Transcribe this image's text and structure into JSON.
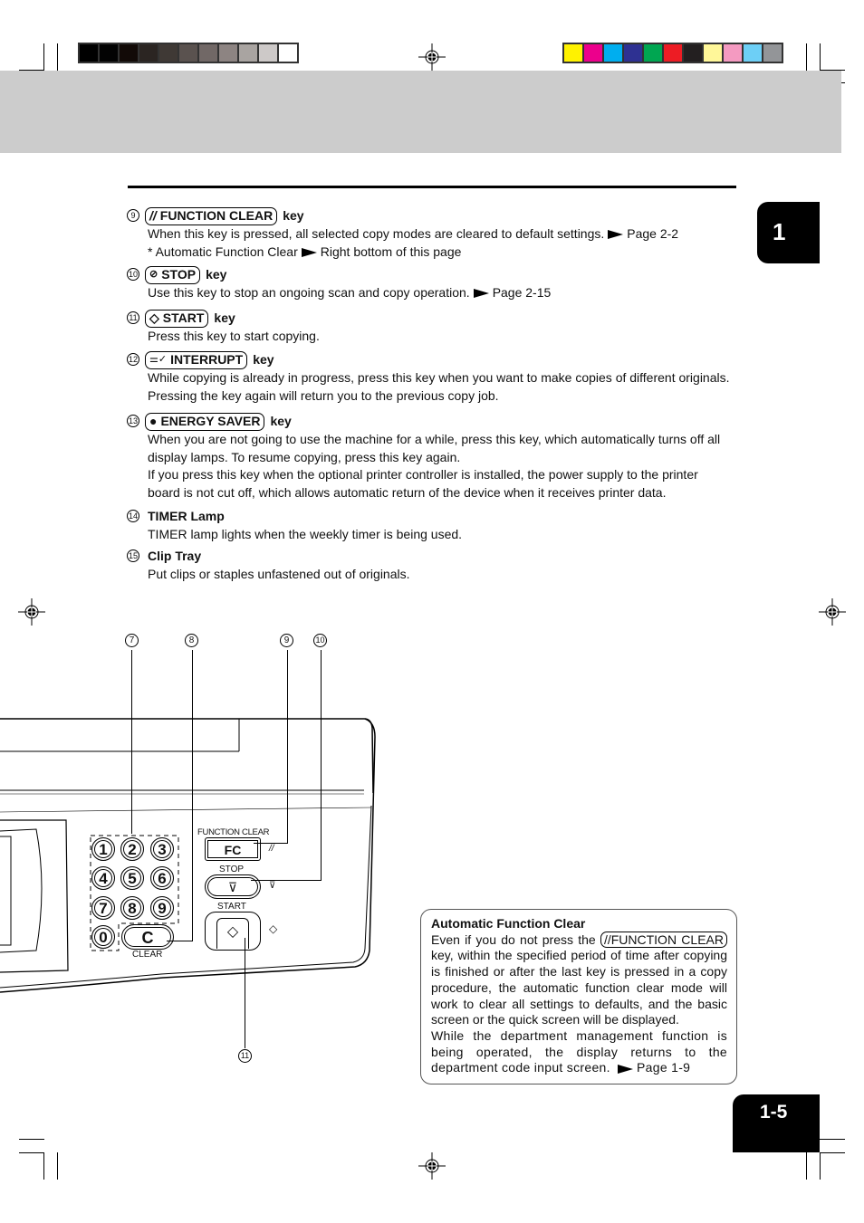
{
  "chapter_tab": "1",
  "page_number": "1-5",
  "color_bars": {
    "grayscale": [
      "#000000",
      "#030303",
      "#120a07",
      "#2b2522",
      "#3f3935",
      "#5a524f",
      "#716866",
      "#8d8482",
      "#a9a4a1",
      "#cdc9c8",
      "#ffffff"
    ],
    "process": [
      "#fff200",
      "#ec008c",
      "#00aeef",
      "#2e3192",
      "#00a651",
      "#ed1c24",
      "#231f20",
      "#fff799",
      "#f49ac1",
      "#6dcff6",
      "#939598"
    ]
  },
  "items": [
    {
      "num": "9",
      "icon": "function-clear-icon",
      "icon_glyph": "//",
      "key": "FUNCTION CLEAR",
      "suffix": "key",
      "lines": [
        "When this key is pressed, all selected copy modes are cleared to default settings.",
        "* Automatic Function Clear"
      ],
      "refs": [
        "Page 2-2",
        "Right bottom of this page"
      ]
    },
    {
      "num": "10",
      "icon": "stop-icon",
      "icon_glyph": "⊘",
      "key": "STOP",
      "suffix": "key",
      "lines": [
        "Use this key to stop an ongoing scan and copy operation."
      ],
      "refs": [
        "Page 2-15"
      ]
    },
    {
      "num": "11",
      "icon": "start-icon",
      "icon_glyph": "◇",
      "key": "START",
      "suffix": "key",
      "lines": [
        "Press this key to start copying."
      ]
    },
    {
      "num": "12",
      "icon": "interrupt-icon",
      "icon_glyph": "⚌✓",
      "key": "INTERRUPT",
      "suffix": "key",
      "lines": [
        "While copying is already in progress, press this key when you want to make copies of different originals.",
        "Pressing the key again will return you to the previous copy job."
      ]
    },
    {
      "num": "13",
      "icon": "energy-saver-icon",
      "icon_glyph": "●",
      "key": "ENERGY SAVER",
      "suffix": "key",
      "lines": [
        "When you are not going to use the machine for a while, press this key, which automatically turns off all",
        "display lamps. To resume copying, press this key again.",
        "If you press this key when the optional printer controller is installed, the power supply to the printer",
        "board is not cut off, which allows automatic return of the device when it receives printer data."
      ]
    },
    {
      "num": "14",
      "title": "TIMER Lamp",
      "lines": [
        "TIMER lamp lights when the weekly timer is being used."
      ]
    },
    {
      "num": "15",
      "title": "Clip Tray",
      "lines": [
        "Put clips or staples unfastened out of originals."
      ]
    }
  ],
  "diagram": {
    "callouts": [
      "7",
      "8",
      "9",
      "10",
      "11"
    ],
    "keypad": [
      "1",
      "2",
      "3",
      "4",
      "5",
      "6",
      "7",
      "8",
      "9",
      "0"
    ],
    "clear_key": "C",
    "clear_label": "CLEAR",
    "function_clear_label": "FUNCTION CLEAR",
    "fc_key": "FC",
    "stop_label": "STOP",
    "start_label": "START"
  },
  "note": {
    "title": "Automatic Function Clear",
    "text_before_key": "Even if you do not press the",
    "key": "//FUNCTION CLEAR",
    "text_after_key": "key, within the specified period of time after copying is finished or after the last key is pressed in a copy procedure, the automatic function clear mode will work to clear all settings to defaults, and the basic screen or the quick screen will be displayed.",
    "text2": "While the department management function is being operated, the display returns to the department code input screen.",
    "ref": "Page 1-9"
  }
}
